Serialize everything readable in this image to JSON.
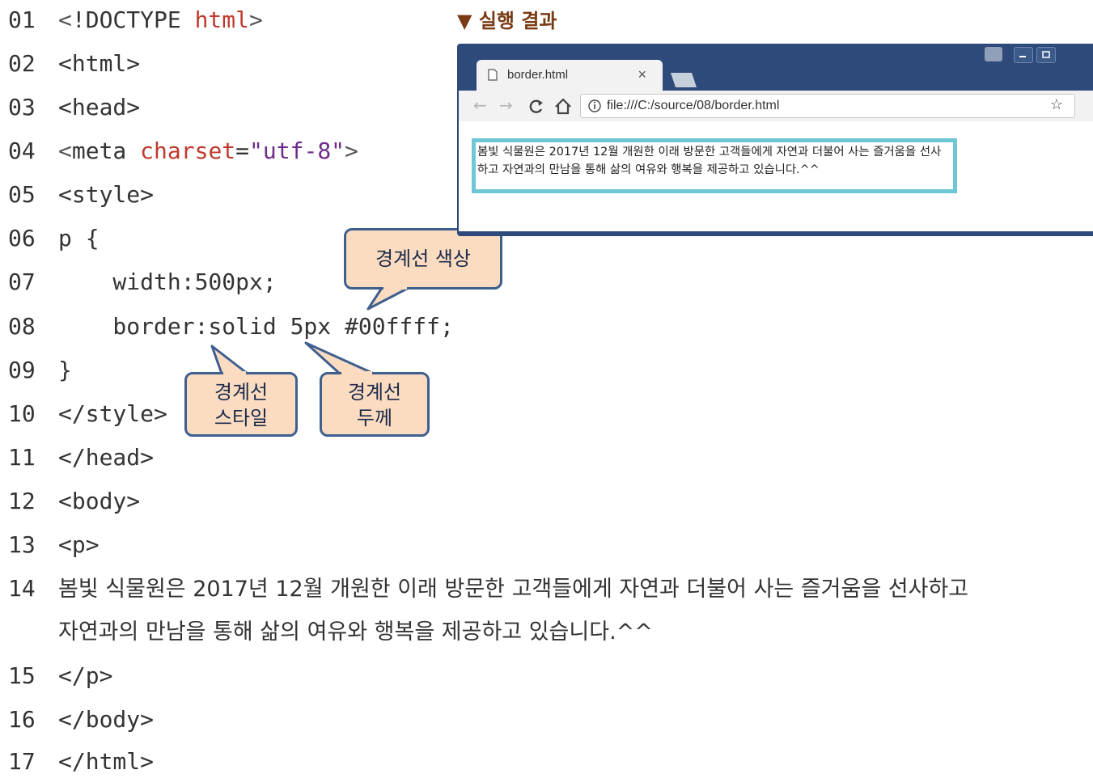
{
  "code": {
    "lines": [
      {
        "num": "01",
        "text": "<!DOCTYPE html>"
      },
      {
        "num": "02",
        "text": "<html>"
      },
      {
        "num": "03",
        "text": "<head>"
      },
      {
        "num": "04",
        "text": "<meta charset=\"utf-8\">"
      },
      {
        "num": "05",
        "text": "<style>"
      },
      {
        "num": "06",
        "text": "p {"
      },
      {
        "num": "07",
        "text": "    width:500px;"
      },
      {
        "num": "08",
        "text": "    border:solid 5px #00ffff;"
      },
      {
        "num": "09",
        "text": "}"
      },
      {
        "num": "10",
        "text": "</style>"
      },
      {
        "num": "11",
        "text": "</head>"
      },
      {
        "num": "12",
        "text": "<body>"
      },
      {
        "num": "13",
        "text": "<p>"
      },
      {
        "num": "14",
        "text": "봄빛 식물원은 2017년 12월 개원한 이래 방문한 고객들에게 자연과 더불어 사는 즐거움을 선사하고"
      },
      {
        "num": "",
        "text": "자연과의 만남을 통해 삶의 여유와 행복을 제공하고 있습니다.^^"
      },
      {
        "num": "15",
        "text": "</p>"
      },
      {
        "num": "16",
        "text": "</body>"
      },
      {
        "num": "17",
        "text": "</html>"
      }
    ],
    "tokens": {
      "l01": {
        "lt": "<",
        "tag": "!DOCTYPE",
        "attr": "html",
        "gt": ">"
      },
      "l04": {
        "lt": "<",
        "tag": "meta",
        "attr": "charset",
        "eq": "=",
        "val": "\"utf-8\"",
        "gt": ">"
      }
    }
  },
  "callouts": {
    "color": "경계선 색상",
    "style_line1": "경계선",
    "style_line2": "스타일",
    "width_line1": "경계선",
    "width_line2": "두께"
  },
  "result": {
    "title": "▼ 실행 결과",
    "tab_label": "border.html",
    "url": "file:///C:/source/08/border.html",
    "paragraph": "봄빛 식물원은 2017년 12월 개원한 이래 방문한 고객들에게 자연과 더불어 사는 즐거움을 선사하고 자연과의 만남을 통해 삶의 여유와 행복을 제공하고 있습니다.^^",
    "border_color": "#6fc7d6"
  },
  "colors": {
    "keyword": "#c0392b",
    "string": "#6d2b8a",
    "callout_fill": "#fbdcc1",
    "callout_border": "#3f5f8f",
    "browser_frame": "#2e4a7a"
  }
}
